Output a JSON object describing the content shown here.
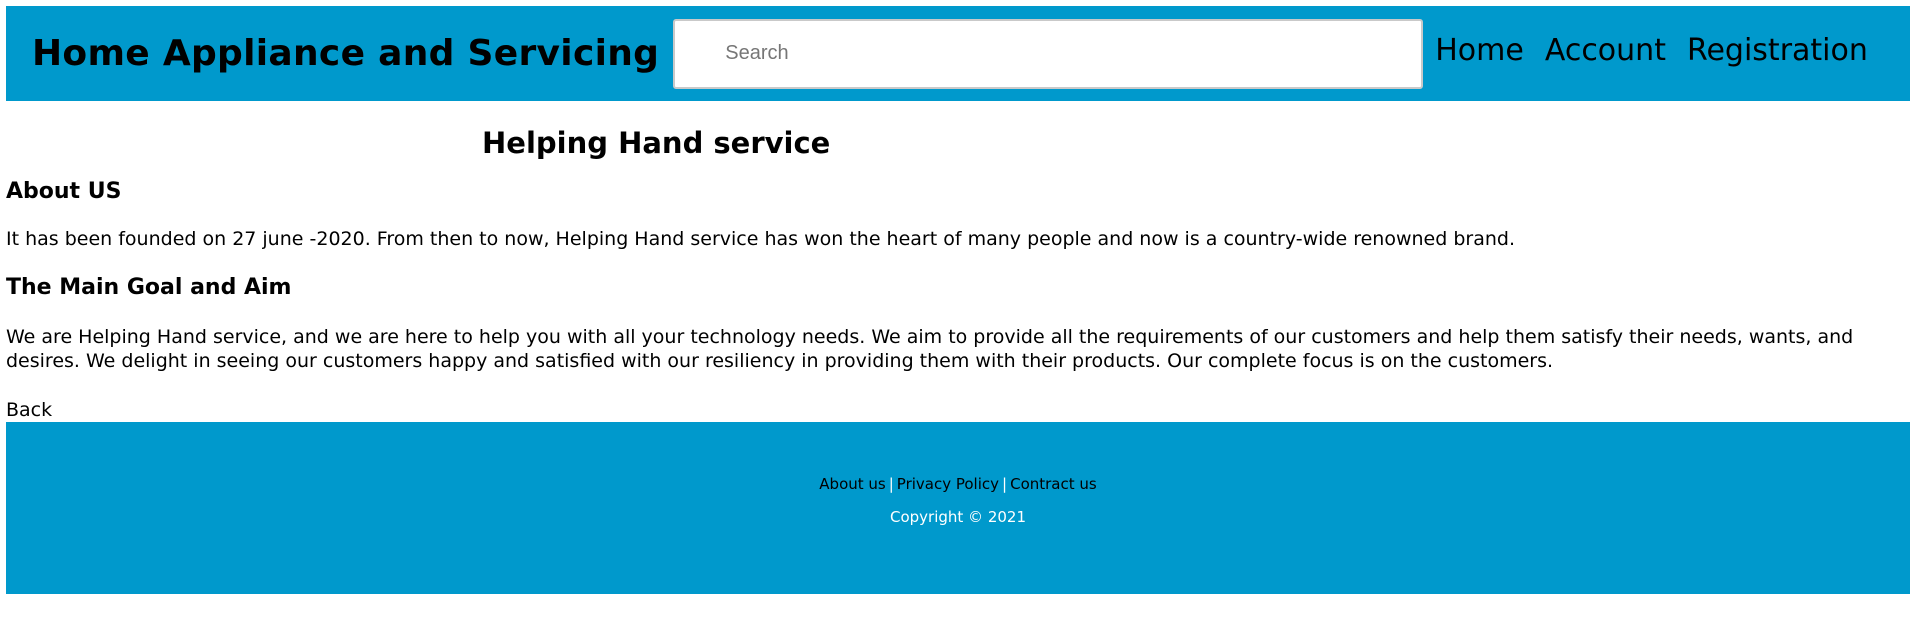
{
  "header": {
    "brand": "Home Appliance and Servicing",
    "search": {
      "placeholder": "Search",
      "value": ""
    },
    "nav": [
      {
        "label": "Home"
      },
      {
        "label": "Account"
      },
      {
        "label": "Registration"
      }
    ],
    "background_color": "#0099cc"
  },
  "main": {
    "title": "Helping Hand service",
    "about_heading": "About US",
    "about_text": "It has been founded on 27 june -2020. From then to now, Helping Hand service has won the heart of many people and now is a country-wide renowned brand.",
    "goal_heading": "The Main Goal and Aim",
    "goal_text": "We are Helping Hand service, and we are here to help you with all your technology needs. We aim to provide all the requirements of our customers and help them satisfy their needs, wants, and desires. We delight in seeing our customers happy and satisfied with our resiliency in providing them with their products. Our complete focus is on the customers.",
    "back_label": "Back"
  },
  "footer": {
    "links": [
      {
        "label": "About us"
      },
      {
        "label": "Privacy Policy"
      },
      {
        "label": "Contract us"
      }
    ],
    "separator": "|",
    "copyright": "Copyright © 2021",
    "background_color": "#0099cc"
  }
}
